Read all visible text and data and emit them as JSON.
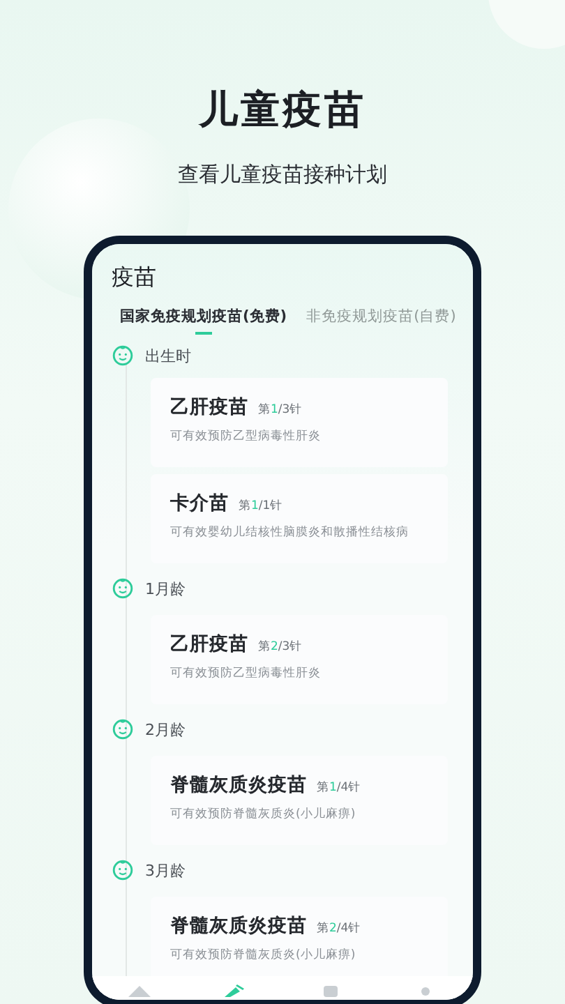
{
  "hero": {
    "title": "儿童疫苗",
    "subtitle": "查看儿童疫苗接种计划"
  },
  "screen": {
    "title": "疫苗",
    "tabs": [
      {
        "label": "国家免疫规划疫苗(免费)",
        "selected": true
      },
      {
        "label": "非免疫规划疫苗(自费)",
        "selected": false
      }
    ],
    "groups": [
      {
        "age": "出生时",
        "vaccines": [
          {
            "name": "乙肝疫苗",
            "dose_prefix": "第",
            "dose_current": "1",
            "dose_rest": "/3针",
            "description": "可有效预防乙型病毒性肝炎"
          },
          {
            "name": "卡介苗",
            "dose_prefix": "第",
            "dose_current": "1",
            "dose_rest": "/1针",
            "description": "可有效婴幼儿结核性脑膜炎和散播性结核病"
          }
        ]
      },
      {
        "age": "1月龄",
        "vaccines": [
          {
            "name": "乙肝疫苗",
            "dose_prefix": "第",
            "dose_current": "2",
            "dose_rest": "/3针",
            "description": "可有效预防乙型病毒性肝炎"
          }
        ]
      },
      {
        "age": "2月龄",
        "vaccines": [
          {
            "name": "脊髓灰质炎疫苗",
            "dose_prefix": "第",
            "dose_current": "1",
            "dose_rest": "/4针",
            "description": "可有效预防脊髓灰质炎(小儿麻痹)"
          }
        ]
      },
      {
        "age": "3月龄",
        "vaccines": [
          {
            "name": "脊髓灰质炎疫苗",
            "dose_prefix": "第",
            "dose_current": "2",
            "dose_rest": "/4针",
            "description": "可有效预防脊髓灰质炎(小儿麻痹)"
          }
        ]
      }
    ],
    "nav": [
      {
        "kind": "home",
        "selected": false
      },
      {
        "kind": "vaccine",
        "selected": true
      },
      {
        "kind": "record",
        "selected": false
      },
      {
        "kind": "profile",
        "selected": false
      }
    ]
  }
}
